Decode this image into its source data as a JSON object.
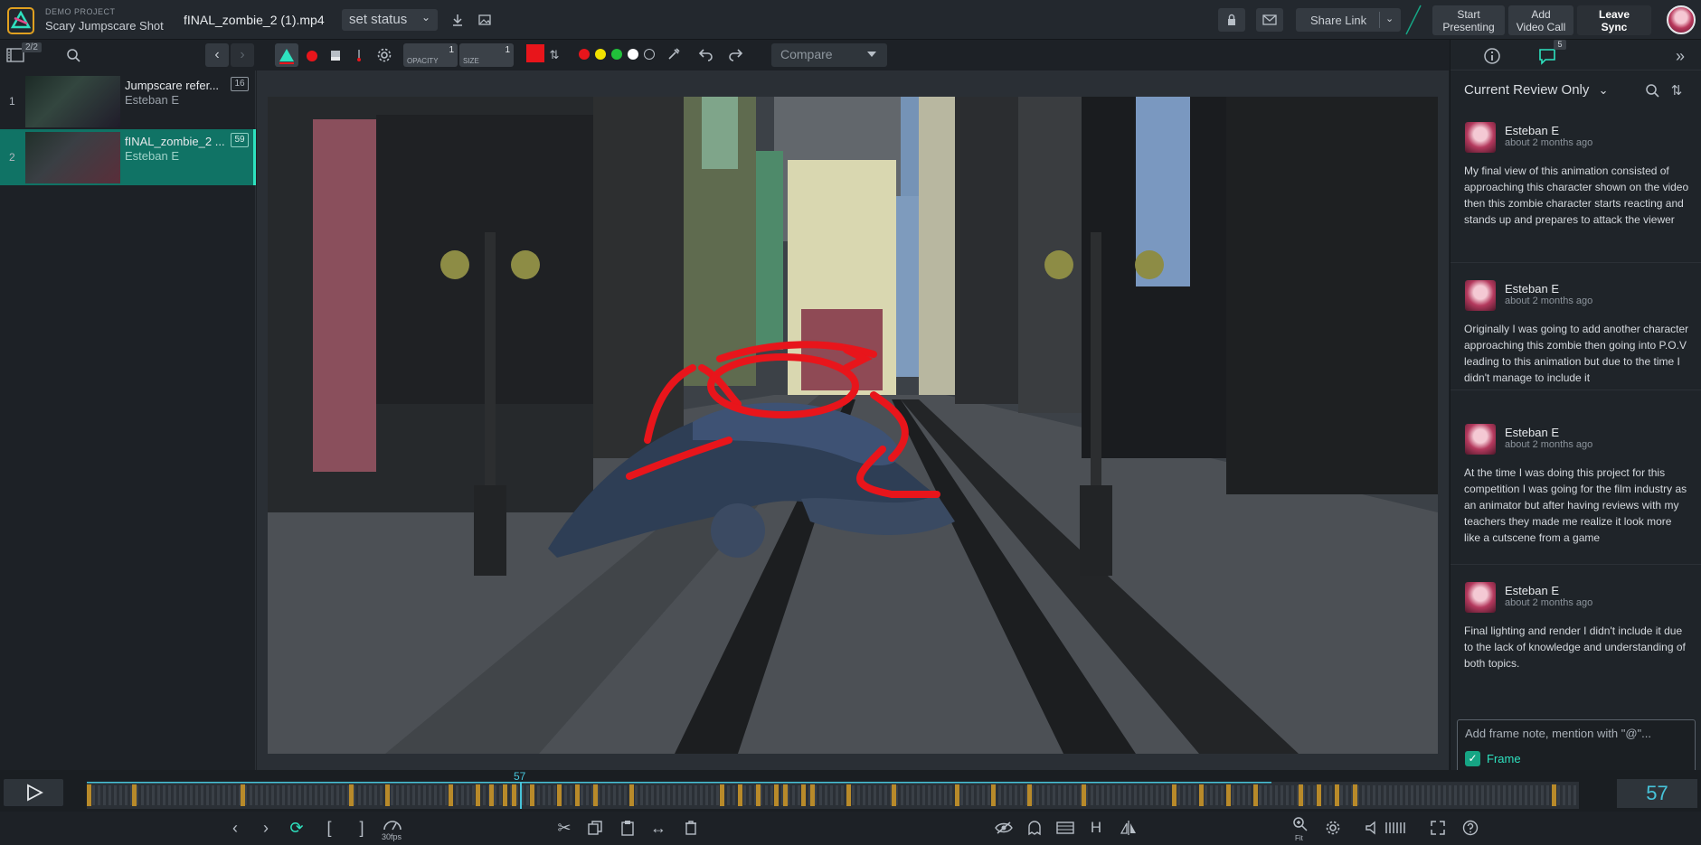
{
  "header": {
    "project_kicker": "DEMO PROJECT",
    "project_name": "Scary Jumpscare Shot",
    "file_name": "fINAL_zombie_2 (1).mp4",
    "status_label": "set status",
    "share_label": "Share Link",
    "start_presenting": [
      "Start",
      "Presenting"
    ],
    "add_video_call": [
      "Add",
      "Video Call"
    ],
    "leave_sync": [
      "Leave",
      "Sync"
    ]
  },
  "toolbar": {
    "item_count": "2/2",
    "opacity_label": "OPACITY",
    "opacity_value": "1",
    "size_label": "SIZE",
    "size_value": "1",
    "compare_label": "Compare",
    "stroke_color": "#e8151b",
    "palette": [
      "#e8151b",
      "#f2e200",
      "#21c13a",
      "#ffffff",
      "#1d2126"
    ]
  },
  "versions": [
    {
      "index": "1",
      "title": "Jumpscare refer...",
      "author": "Esteban E",
      "comments": "16",
      "active": false
    },
    {
      "index": "2",
      "title": "fINAL_zombie_2 ...",
      "author": "Esteban E",
      "comments": "59",
      "active": true
    }
  ],
  "review": {
    "filter_label": "Current Review Only",
    "comment_count_badge": "5",
    "comments": [
      {
        "author": "Esteban E",
        "time": "about 2 months ago",
        "text": "My final view of this animation consisted of approaching this character shown on the video then this zombie character starts reacting and stands up and prepares to attack the viewer"
      },
      {
        "author": "Esteban E",
        "time": "about 2 months ago",
        "text": "Originally I was going to add another character approaching this zombie then going into P.O.V leading to this animation but due to the time I didn't manage to include it"
      },
      {
        "author": "Esteban E",
        "time": "about 2 months ago",
        "text": "At the time I was doing this project for this competition I was going for the film industry as an animator but after having reviews with my teachers they made me realize it look more like a cutscene from a game"
      },
      {
        "author": "Esteban E",
        "time": "about 2 months ago",
        "text": "Final lighting and render I didn't include it due to the lack of knowledge and understanding of both topics."
      }
    ],
    "note_placeholder": "Add frame note, mention with \"@\"...",
    "frame_checkbox_label": "Frame"
  },
  "timeline": {
    "current_frame": "57",
    "current_frame_top": "57",
    "fps_label": "30fps",
    "fit_label": "Fit",
    "accent": "#47c3d9",
    "marker_color": "#b88a2a"
  }
}
